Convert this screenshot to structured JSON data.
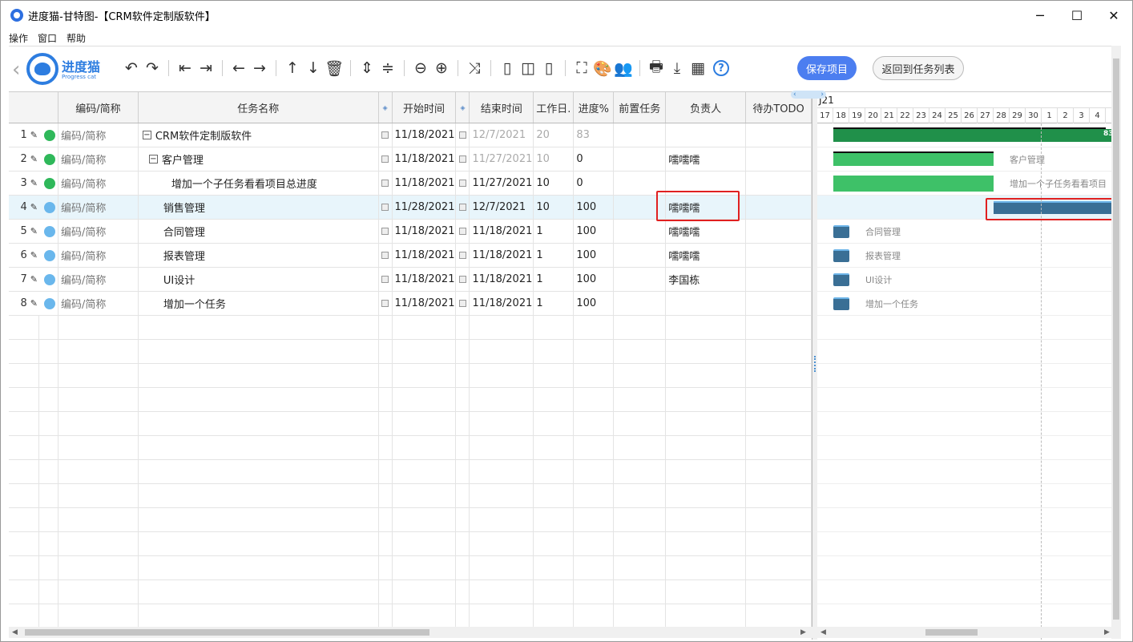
{
  "window": {
    "title": "进度猫-甘特图-【CRM软件定制版软件】",
    "minimize": "─",
    "maximize": "☐",
    "close": "✕"
  },
  "menu": [
    "操作",
    "窗口",
    "帮助"
  ],
  "logo": {
    "name": "进度猫",
    "sub": "Progress cat",
    "chevron": "‹"
  },
  "toolbar": {
    "icons": [
      {
        "name": "undo-icon",
        "glyph": "↶"
      },
      {
        "name": "redo-icon",
        "glyph": "↷"
      },
      {
        "sep": true
      },
      {
        "name": "outdent-icon",
        "glyph": "⇤"
      },
      {
        "name": "indent-icon",
        "glyph": "⇥"
      },
      {
        "sep": true
      },
      {
        "name": "move-left-icon",
        "glyph": "←"
      },
      {
        "name": "move-right-icon",
        "glyph": "→"
      },
      {
        "sep": true
      },
      {
        "name": "move-up-icon",
        "glyph": "↑"
      },
      {
        "name": "move-down-icon",
        "glyph": "↓"
      },
      {
        "name": "delete-icon",
        "glyph": "🗑"
      },
      {
        "sep": true
      },
      {
        "name": "expand-rows-icon",
        "glyph": "⇕"
      },
      {
        "name": "collapse-rows-icon",
        "glyph": "≑"
      },
      {
        "sep": true
      },
      {
        "name": "zoom-out-icon",
        "glyph": "⊖"
      },
      {
        "name": "zoom-in-icon",
        "glyph": "⊕"
      },
      {
        "sep": true
      },
      {
        "name": "link-icon",
        "glyph": "⤨"
      },
      {
        "sep": true
      },
      {
        "name": "layout-left-icon",
        "glyph": "▯"
      },
      {
        "name": "layout-split-icon",
        "glyph": "◫"
      },
      {
        "name": "layout-right-icon",
        "glyph": "▯"
      },
      {
        "sep": true
      },
      {
        "name": "fullscreen-icon",
        "glyph": "⛶"
      },
      {
        "name": "palette-icon",
        "glyph": "🎨"
      },
      {
        "name": "users-icon",
        "glyph": "👥"
      },
      {
        "sep": true
      },
      {
        "name": "print-icon",
        "glyph": "🖶"
      },
      {
        "name": "download-icon",
        "glyph": "⤓"
      },
      {
        "name": "excel-icon",
        "glyph": "▦"
      },
      {
        "name": "help-icon",
        "glyph": "?"
      }
    ],
    "save_label": "保存项目",
    "back_label": "返回到任务列表"
  },
  "grid": {
    "headers": {
      "code": "编码/简称",
      "name": "任务名称",
      "start": "开始时间",
      "end": "结束时间",
      "days": "工作日.",
      "progress": "进度%",
      "predecessor": "前置任务",
      "owner": "负责人",
      "todo": "待办TODO"
    },
    "header_marker": "◈",
    "rows": [
      {
        "num": "1",
        "status": "green",
        "code": "编码/简称",
        "toggle": "−",
        "indent": 0,
        "name": "CRM软件定制版软件",
        "start": "11/18/2021",
        "end": "12/7/2021",
        "end_muted": true,
        "days": "20",
        "days_muted": true,
        "progress": "83",
        "progress_muted": true,
        "predecessor": "",
        "owner": "",
        "todo": ""
      },
      {
        "num": "2",
        "status": "green",
        "code": "编码/简称",
        "toggle": "−",
        "indent": 1,
        "name": "客户管理",
        "start": "11/18/2021",
        "end": "11/27/2021",
        "end_muted": true,
        "days": "10",
        "days_muted": true,
        "progress": "0",
        "progress_muted": false,
        "predecessor": "",
        "owner": "嚅嚅嚅",
        "todo": ""
      },
      {
        "num": "3",
        "status": "green",
        "code": "编码/简称",
        "toggle": "",
        "indent": 2,
        "name": "增加一个子任务看看项目总进度",
        "start": "11/18/2021",
        "end": "11/27/2021",
        "end_muted": false,
        "days": "10",
        "days_muted": false,
        "progress": "0",
        "progress_muted": false,
        "predecessor": "",
        "owner": "",
        "todo": ""
      },
      {
        "num": "4",
        "status": "blue",
        "code": "编码/简称",
        "toggle": "",
        "indent": 1,
        "name": "销售管理",
        "start": "11/28/2021",
        "end": "12/7/2021",
        "end_muted": false,
        "days": "10",
        "days_muted": false,
        "progress": "100",
        "progress_muted": false,
        "predecessor": "",
        "owner": "嚅嚅嚅",
        "todo": "",
        "selected": true
      },
      {
        "num": "5",
        "status": "blue",
        "code": "编码/简称",
        "toggle": "",
        "indent": 1,
        "name": "合同管理",
        "start": "11/18/2021",
        "end": "11/18/2021",
        "end_muted": false,
        "days": "1",
        "days_muted": false,
        "progress": "100",
        "progress_muted": false,
        "predecessor": "",
        "owner": "嚅嚅嚅",
        "todo": ""
      },
      {
        "num": "6",
        "status": "blue",
        "code": "编码/简称",
        "toggle": "",
        "indent": 1,
        "name": "报表管理",
        "start": "11/18/2021",
        "end": "11/18/2021",
        "end_muted": false,
        "days": "1",
        "days_muted": false,
        "progress": "100",
        "progress_muted": false,
        "predecessor": "",
        "owner": "嚅嚅嚅",
        "todo": ""
      },
      {
        "num": "7",
        "status": "blue",
        "code": "编码/简称",
        "toggle": "",
        "indent": 1,
        "name": "UI设计",
        "start": "11/18/2021",
        "end": "11/18/2021",
        "end_muted": false,
        "days": "1",
        "days_muted": false,
        "progress": "100",
        "progress_muted": false,
        "predecessor": "",
        "owner": "李国栋",
        "todo": ""
      },
      {
        "num": "8",
        "status": "blue",
        "code": "编码/简称",
        "toggle": "",
        "indent": 1,
        "name": "增加一个任务",
        "start": "11/18/2021",
        "end": "11/18/2021",
        "end_muted": false,
        "days": "1",
        "days_muted": false,
        "progress": "100",
        "progress_muted": false,
        "predecessor": "",
        "owner": "",
        "todo": ""
      }
    ],
    "empty_rows": 13
  },
  "gantt": {
    "month_label": "J21",
    "nav_prev": "‹",
    "nav_next": "›",
    "days": [
      "17",
      "18",
      "19",
      "20",
      "21",
      "22",
      "23",
      "24",
      "25",
      "26",
      "27",
      "28",
      "29",
      "30",
      "1",
      "2",
      "3",
      "4"
    ],
    "summary_percent": "83",
    "labels": {
      "r2": "客户管理",
      "r3": "增加一个子任务看看项目",
      "r5": "合同管理",
      "r6": "报表管理",
      "r7": "UI设计",
      "r8": "增加一个任务"
    }
  },
  "colors": {
    "accent": "#4c7ef0",
    "status_green": "#2fb85a",
    "status_blue": "#6ab7ec",
    "highlight": "#e02020"
  }
}
